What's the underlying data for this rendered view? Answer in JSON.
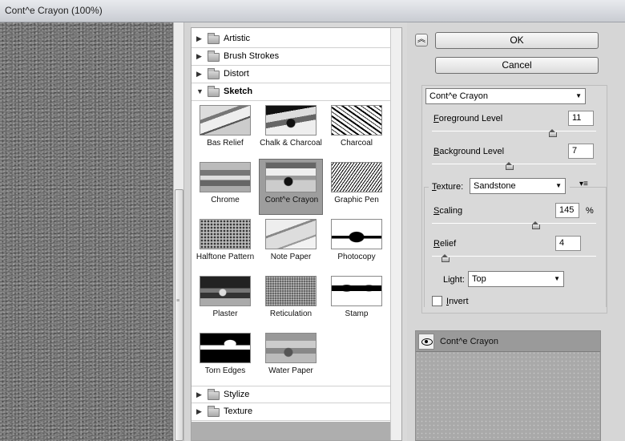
{
  "window": {
    "title": "Cont^e Crayon (100%)"
  },
  "gallery": {
    "categories_top": [
      {
        "label": "Artistic"
      },
      {
        "label": "Brush Strokes"
      },
      {
        "label": "Distort"
      },
      {
        "label": "Sketch"
      }
    ],
    "categories_bottom": [
      {
        "label": "Stylize"
      },
      {
        "label": "Texture"
      }
    ],
    "filters": [
      {
        "label": "Bas Relief",
        "icon": "bas-relief-thumbnail"
      },
      {
        "label": "Chalk & Charcoal",
        "icon": "chalk-charcoal-thumbnail"
      },
      {
        "label": "Charcoal",
        "icon": "charcoal-thumbnail"
      },
      {
        "label": "Chrome",
        "icon": "chrome-thumbnail"
      },
      {
        "label": "Cont^e Crayon",
        "icon": "conte-crayon-thumbnail",
        "selected": true
      },
      {
        "label": "Graphic Pen",
        "icon": "graphic-pen-thumbnail"
      },
      {
        "label": "Halftone Pattern",
        "icon": "halftone-thumbnail"
      },
      {
        "label": "Note Paper",
        "icon": "note-paper-thumbnail"
      },
      {
        "label": "Photocopy",
        "icon": "photocopy-thumbnail"
      },
      {
        "label": "Plaster",
        "icon": "plaster-thumbnail"
      },
      {
        "label": "Reticulation",
        "icon": "reticulation-thumbnail"
      },
      {
        "label": "Stamp",
        "icon": "stamp-thumbnail"
      },
      {
        "label": "Torn Edges",
        "icon": "torn-edges-thumbnail"
      },
      {
        "label": "Water Paper",
        "icon": "water-paper-thumbnail"
      }
    ]
  },
  "buttons": {
    "ok": "OK",
    "cancel": "Cancel"
  },
  "settings": {
    "filter_select": "Cont^e Crayon",
    "foreground": {
      "label_u": "F",
      "label_rest": "oreground Level",
      "value": "11",
      "level": 0.73
    },
    "background": {
      "label_u": "B",
      "label_rest": "ackground Level",
      "value": "7",
      "level": 0.47
    },
    "texture": {
      "label_u": "T",
      "label_rest": "exture:",
      "value": "Sandstone"
    },
    "scaling": {
      "label_u": "S",
      "label_rest": "caling",
      "value": "145",
      "unit": "%",
      "level": 0.63
    },
    "relief": {
      "label_u": "R",
      "label_rest": "elief",
      "value": "4",
      "level": 0.08
    },
    "light": {
      "label": "Light:",
      "label_u": "i",
      "value": "Top"
    },
    "invert": {
      "label": "Invert",
      "label_u": "I",
      "label_rest": "nvert",
      "checked": false
    }
  },
  "layers": {
    "items": [
      {
        "name": "Cont^e Crayon",
        "visible": true
      }
    ]
  }
}
